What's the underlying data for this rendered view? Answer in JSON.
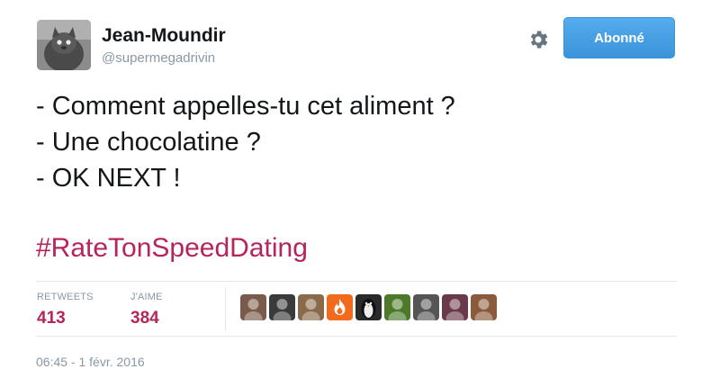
{
  "author": {
    "name": "Jean-Moundir",
    "handle": "@supermegadrivin",
    "avatar_icon": "cat-avatar-icon"
  },
  "actions": {
    "settings_icon": "gear-icon",
    "follow_label": "Abonné",
    "follow_color": "#55acee"
  },
  "tweet": {
    "lines": [
      "- Comment appelles-tu cet aliment ?",
      "- Une chocolatine ?",
      "- OK NEXT !"
    ],
    "hashtag": "#RateTonSpeedDating",
    "hashtag_color": "#b5245a"
  },
  "stats": {
    "retweets_label": "RETWEETS",
    "retweets_value": "413",
    "likes_label": "J'AIME",
    "likes_value": "384"
  },
  "likers": [
    {
      "icon": "user-avatar-icon",
      "color": "#7a5a4a"
    },
    {
      "icon": "user-avatar-icon",
      "color": "#3a3a3a"
    },
    {
      "icon": "user-avatar-icon",
      "color": "#8a6a4a"
    },
    {
      "icon": "flame-icon",
      "color": "#f26b1d"
    },
    {
      "icon": "penguin-avatar-icon",
      "color": "#2a2a2a"
    },
    {
      "icon": "user-avatar-icon",
      "color": "#4c7a2a"
    },
    {
      "icon": "user-avatar-icon",
      "color": "#555555"
    },
    {
      "icon": "user-avatar-icon",
      "color": "#6a3a4a"
    },
    {
      "icon": "user-avatar-icon",
      "color": "#8a5a3a"
    }
  ],
  "timestamp": "06:45 - 1 févr. 2016"
}
